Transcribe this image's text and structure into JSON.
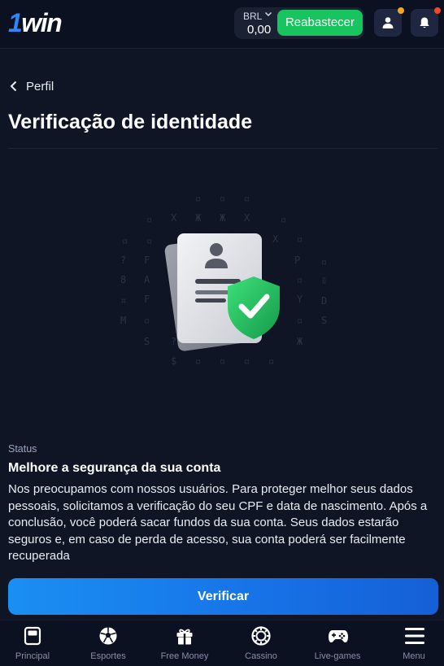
{
  "header": {
    "logo_number": "1",
    "logo_word": "win",
    "currency": "BRL",
    "balance": "0,00",
    "topup_label": "Reabastecer",
    "profile_badge_color": "#f5a623",
    "notification_badge_color": "#f04a25"
  },
  "nav": {
    "back_label": "Perfil"
  },
  "page": {
    "title": "Verificação de identidade"
  },
  "status": {
    "label": "Status",
    "title": "Melhore a segurança da sua conta",
    "description": "Nos preocupamos com nossos usuários. Para proteger melhor seus dados pessoais, solicitamos a verificação do seu CPF e data de nascimento. Após a conclusão, você poderá sacar fundos da sua conta. Seus dados estarão seguros e, em caso de perda de acesso, sua conta poderá ser facilmente recuperada",
    "verify_button": "Verificar"
  },
  "bottom_nav": {
    "items": [
      {
        "label": "Principal",
        "icon": "home-icon"
      },
      {
        "label": "Esportes",
        "icon": "soccer-ball-icon"
      },
      {
        "label": "Free Money",
        "icon": "gift-icon"
      },
      {
        "label": "Cassino",
        "icon": "casino-chip-icon"
      },
      {
        "label": "Live-games",
        "icon": "gamepad-icon"
      },
      {
        "label": "Menu",
        "icon": "hamburger-icon"
      }
    ]
  },
  "colors": {
    "background": "#0f1525",
    "accent_green": "#17c45d",
    "accent_blue": "#1a8ff2"
  }
}
